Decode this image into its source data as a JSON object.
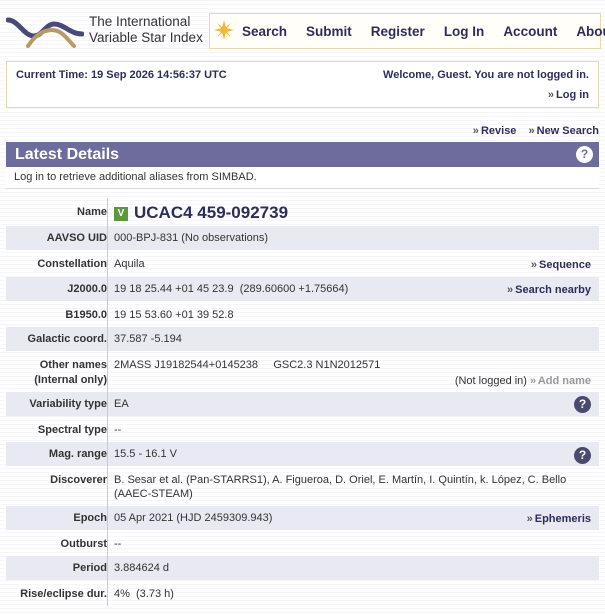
{
  "header": {
    "logo_line1": "The International",
    "logo_line2": "Variable Star Index",
    "nav": [
      "Search",
      "Submit",
      "Register",
      "Log In",
      "Account",
      "About"
    ]
  },
  "status": {
    "current_time": "Current Time: 19 Sep 2026 14:56:37 UTC",
    "welcome": "Welcome, Guest. You are not logged in.",
    "login_link": "Log in"
  },
  "actions": {
    "revise": "Revise",
    "new_search": "New Search"
  },
  "panel": {
    "title": "Latest Details",
    "help": "?",
    "simbad_note": "Log in to retrieve additional aliases from SIMBAD."
  },
  "details": {
    "name_label": "Name",
    "vsx_badge": "V",
    "name_value": "UCAC4 459-092739",
    "uid_label": "AAVSO UID",
    "uid_value": "000-BPJ-831 (No observations)",
    "constellation_label": "Constellation",
    "constellation_value": "Aquila",
    "constellation_link": "Sequence",
    "j2000_label": "J2000.0",
    "j2000_value": "19 18 25.44 +01 45 23.9  (289.60600 +1.75664)",
    "j2000_link": "Search nearby",
    "b1950_label": "B1950.0",
    "b1950_value": "19 15 53.60 +01 39 52.8",
    "galactic_label": "Galactic coord.",
    "galactic_value": "37.587 -5.194",
    "other_names_label": "Other names",
    "other_names_sublabel": "(Internal only)",
    "other_names_value": "2MASS J19182544+0145238     GSC2.3 N1N2012571",
    "not_logged_in": "(Not logged in)",
    "add_name": "Add name",
    "variability_label": "Variability type",
    "variability_value": "EA",
    "spectral_label": "Spectral type",
    "spectral_value": "--",
    "mag_label": "Mag. range",
    "mag_value": "15.5 - 16.1 V",
    "discoverer_label": "Discoverer",
    "discoverer_line1": "B. Sesar et al. (Pan-STARRS1), A. Figueroa, D. Oriel, E. Martín, I. Quintín, k. López, C. Bello",
    "discoverer_line2": "(AAEC-STEAM)",
    "epoch_label": "Epoch",
    "epoch_value": "05 Apr 2021 (HJD 2459309.943)",
    "epoch_link": "Ephemeris",
    "outburst_label": "Outburst",
    "outburst_value": "--",
    "period_label": "Period",
    "period_value": "3.884624 d",
    "rise_label": "Rise/eclipse dur.",
    "rise_value": "4%  (3.73 h)"
  }
}
